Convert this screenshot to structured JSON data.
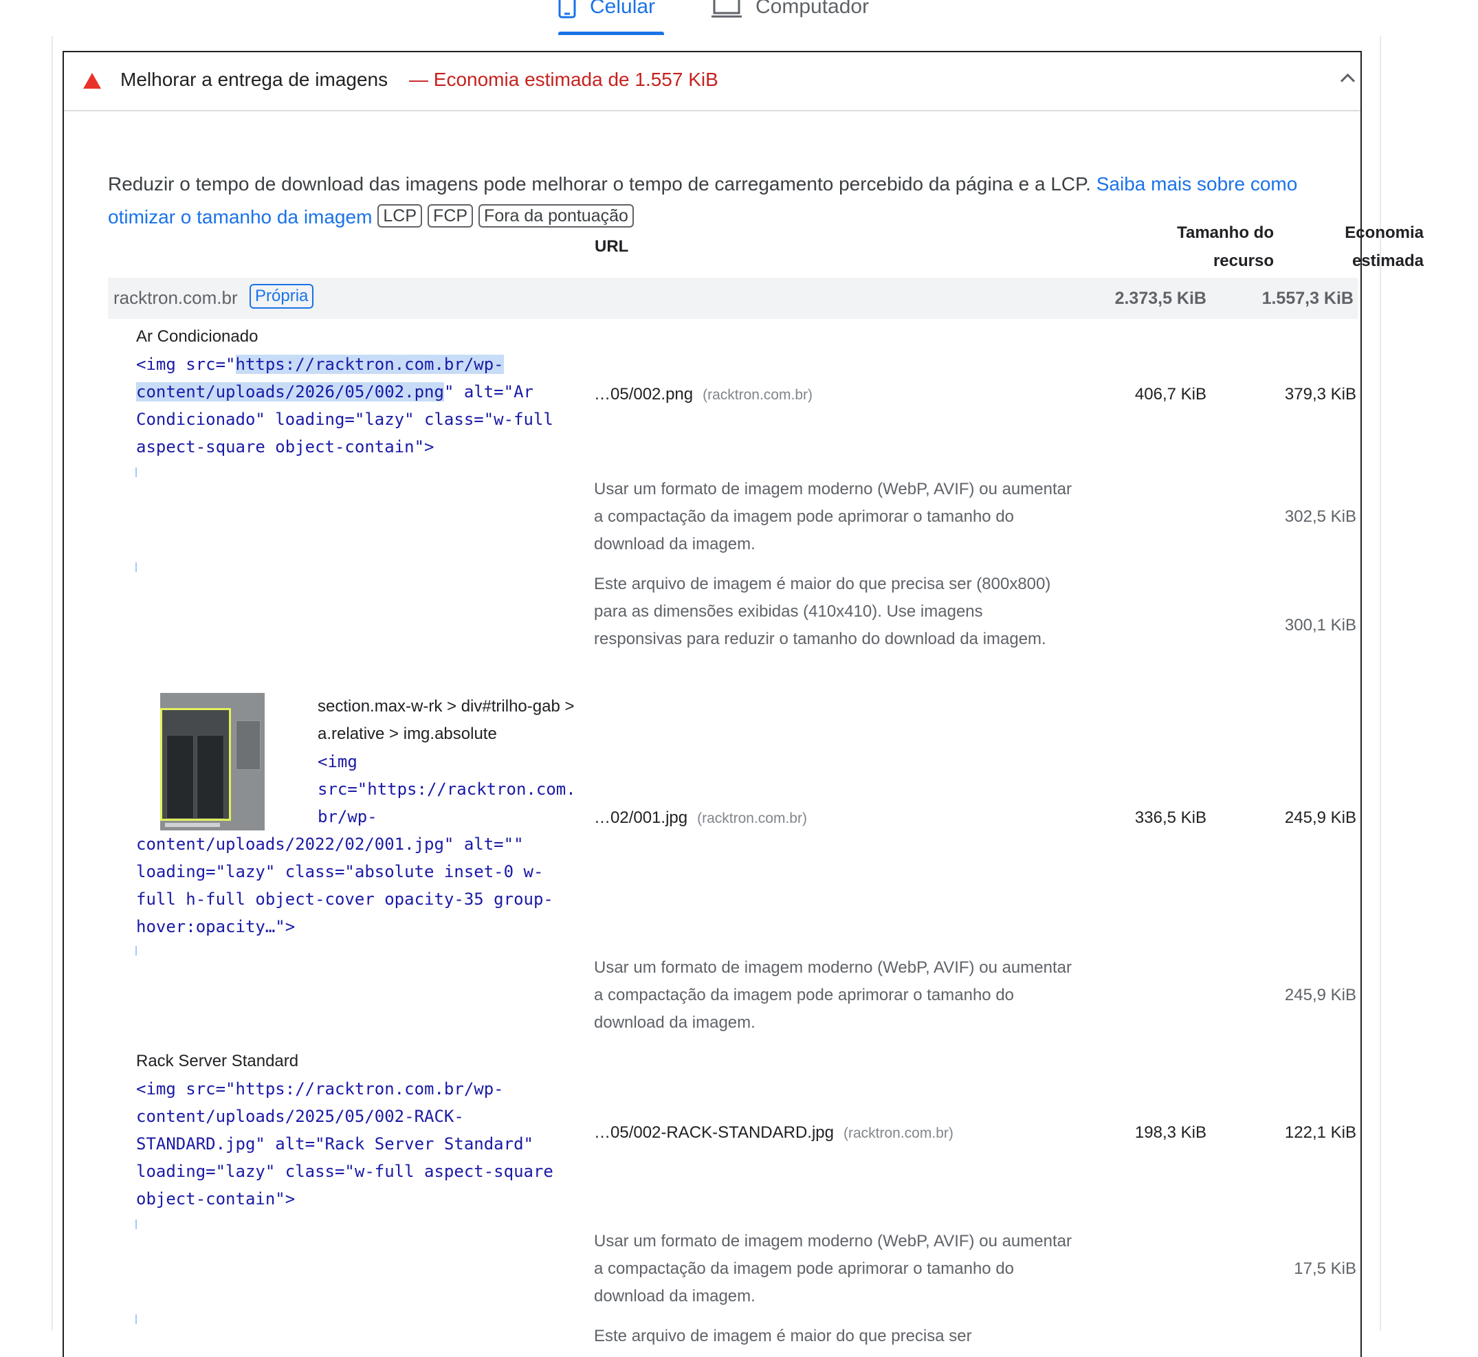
{
  "tabs": {
    "mobile_label": "Celular",
    "desktop_label": "Computador"
  },
  "audit": {
    "title": "Melhorar a entrega de imagens",
    "savings": "— Economia estimada de 1.557 KiB",
    "description": "Reduzir o tempo de download das imagens pode melhorar o tempo de carregamento percebido da página e a LCP. ",
    "link": "Saiba mais sobre como otimizar o tamanho da imagem",
    "tags": [
      "LCP",
      "FCP",
      "Fora da pontuação"
    ]
  },
  "table": {
    "col_url": "URL",
    "col_size_line1": "Tamanho do",
    "col_size_line2": "recurso",
    "col_savings_line1": "Economia",
    "col_savings_line2": "estimada",
    "group": {
      "name": "racktron.com.br",
      "badge": "Própria",
      "size": "2.373,5 KiB",
      "savings": "1.557,3 KiB"
    },
    "rows": [
      {
        "label": "Ar Condicionado",
        "code_1a": "<img src=\"",
        "code_1b": "https://racktron.com.br/wp-",
        "code_2a": "content/uploads/2026/05/002.png",
        "code_2b": "\" alt=\"Ar",
        "code_3": "Condicionado\" loading=\"lazy\" class=\"w-full",
        "code_4": "aspect-square object-contain\">",
        "url": "…05/002.png",
        "host": "(racktron.com.br)",
        "size": "406,7 KiB",
        "savings": "379,3 KiB",
        "sub": [
          {
            "text": "Usar um formato de imagem moderno (WebP, AVIF) ou aumentar a compactação da imagem pode aprimorar o tamanho do download da imagem.",
            "savings": "302,5 KiB"
          },
          {
            "text": "Este arquivo de imagem é maior do que precisa ser (800x800) para as dimensões exibidas (410x410). Use imagens responsivas para reduzir o tamanho do download da imagem.",
            "savings": "300,1 KiB"
          }
        ]
      },
      {
        "selector": "section.max-w-rk > div#trilho-gab > a.relative > img.absolute",
        "code_1": "<img",
        "code_2": "src=\"https://racktron.com.",
        "code_3": "br/wp-",
        "code_4": "content/uploads/2022/02/001.jpg\" alt=\"\"",
        "code_5": "loading=\"lazy\" class=\"absolute inset-0 w-",
        "code_6": "full h-full object-cover opacity-35 group-",
        "code_7": "hover:opacity…\">",
        "url": "…02/001.jpg",
        "host": "(racktron.com.br)",
        "size": "336,5 KiB",
        "savings": "245,9 KiB",
        "sub": [
          {
            "text": "Usar um formato de imagem moderno (WebP, AVIF) ou aumentar a compactação da imagem pode aprimorar o tamanho do download da imagem.",
            "savings": "245,9 KiB"
          }
        ]
      },
      {
        "label": "Rack Server Standard",
        "code_1": "<img src=\"https://racktron.com.br/wp-",
        "code_2": "content/uploads/2025/05/002-RACK-",
        "code_3": "STANDARD.jpg\" alt=\"Rack Server Standard\"",
        "code_4": "loading=\"lazy\" class=\"w-full aspect-square",
        "code_5": "object-contain\">",
        "url": "…05/002-RACK-STANDARD.jpg",
        "host": "(racktron.com.br)",
        "size": "198,3 KiB",
        "savings": "122,1 KiB",
        "sub": [
          {
            "text": "Usar um formato de imagem moderno (WebP, AVIF) ou aumentar a compactação da imagem pode aprimorar o tamanho do download da imagem.",
            "savings": "17,5 KiB"
          },
          {
            "text": "Este arquivo de imagem é maior do que precisa ser"
          }
        ]
      }
    ]
  }
}
